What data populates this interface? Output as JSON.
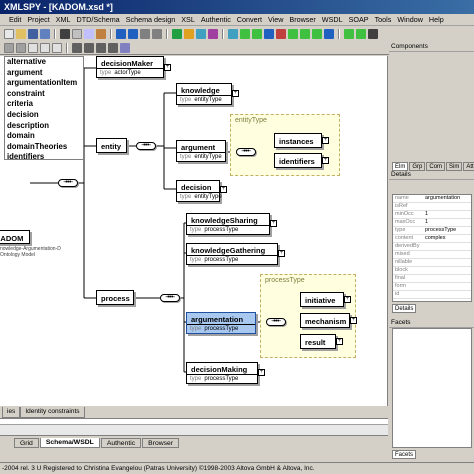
{
  "title": "XMLSPY - [KADOM.xsd *]",
  "menu": [
    "Edit",
    "Project",
    "XML",
    "DTD/Schema",
    "Schema design",
    "XSL",
    "Authentic",
    "Convert",
    "View",
    "Browser",
    "WSDL",
    "SOAP",
    "Tools",
    "Window",
    "Help"
  ],
  "diagram": {
    "root": {
      "name": "KADOM",
      "subtitle1": "nowledge-Argumentation-D",
      "subtitle2": "Ontology Model"
    },
    "type_label": "type",
    "elements": {
      "decisionMaker": {
        "name": "decisionMaker",
        "type": "actorType"
      },
      "entity": {
        "name": "entity"
      },
      "knowledge": {
        "name": "knowledge",
        "type": "entityType"
      },
      "argument": {
        "name": "argument",
        "type": "entityType"
      },
      "decision": {
        "name": "decision",
        "type": "entityType"
      },
      "instances": {
        "name": "instances"
      },
      "identifiers": {
        "name": "identifiers"
      },
      "process": {
        "name": "process"
      },
      "knowledgeSharing": {
        "name": "knowledgeSharing",
        "type": "processType"
      },
      "knowledgeGathering": {
        "name": "knowledgeGathering",
        "type": "processType"
      },
      "argumentation": {
        "name": "argumentation",
        "type": "processType"
      },
      "decisionMaking": {
        "name": "decisionMaking",
        "type": "processType"
      },
      "initiative": {
        "name": "initiative"
      },
      "mechanism": {
        "name": "mechanism"
      },
      "result": {
        "name": "result"
      }
    },
    "groups": {
      "entityType": "entityType",
      "processType": "processType"
    },
    "seq_glyph": "-•••-",
    "plus": "+",
    "minus": "-"
  },
  "bottom_tabs": [
    "ies",
    "Identity constraints"
  ],
  "view_tabs": [
    "Grid",
    "Schema/WSDL",
    "Authentic",
    "Browser"
  ],
  "active_view": "Schema/WSDL",
  "tab_label_hint": "ext",
  "status": "-2004 rel. 3 U    Registered to Christina Evangelou (Patras University)    ©1998-2003 Altova GmbH & Altova, Inc.",
  "components": {
    "title": "Components",
    "items": [
      "alternative",
      "argument",
      "argumentationItem",
      "constraint",
      "criteria",
      "decision",
      "description",
      "domain",
      "domainTheories",
      "identifiers"
    ],
    "tabs": [
      "Elm",
      "Grp",
      "Com",
      "Sim",
      "Att"
    ]
  },
  "details": {
    "title": "Details",
    "rows": [
      {
        "k": "name",
        "v": "argumentation"
      },
      {
        "k": "isRef",
        "v": ""
      },
      {
        "k": "minOcc",
        "v": "1"
      },
      {
        "k": "maxOcc",
        "v": "1"
      },
      {
        "k": "type",
        "v": "processType"
      },
      {
        "k": "content",
        "v": "complex"
      },
      {
        "k": "derivedBy",
        "v": ""
      },
      {
        "k": "mixed",
        "v": ""
      },
      {
        "k": "nillable",
        "v": ""
      },
      {
        "k": "block",
        "v": ""
      },
      {
        "k": "final",
        "v": ""
      },
      {
        "k": "form",
        "v": ""
      },
      {
        "k": "id",
        "v": ""
      }
    ],
    "tab": "Details"
  },
  "facets": {
    "title": "Facets",
    "tab": "Facets"
  },
  "colors": {
    "titlebar": "#0a246a",
    "selected": "#a8c8f0",
    "group_bg": "#ffffe0"
  }
}
